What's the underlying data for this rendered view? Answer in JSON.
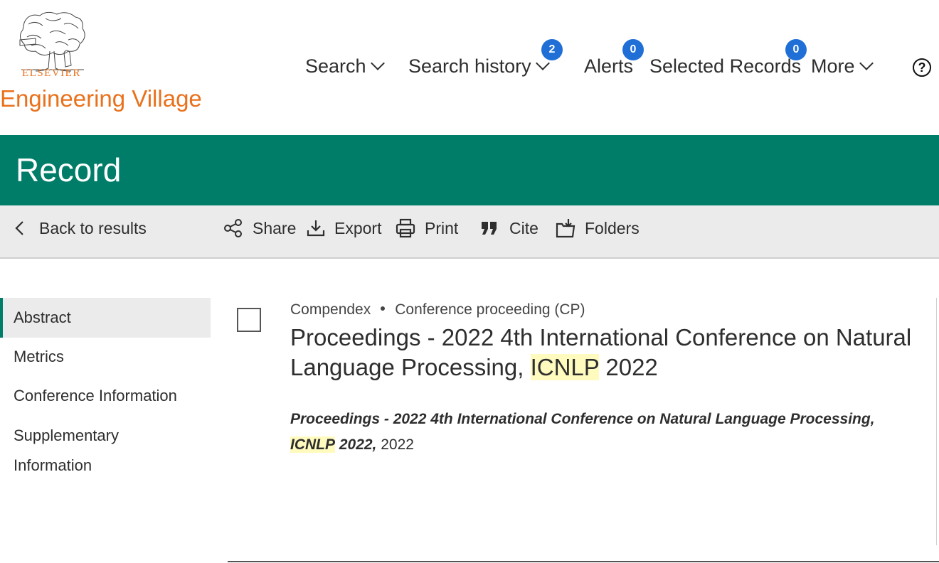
{
  "header": {
    "brand": "ELSEVIER",
    "product": "Engineering Village",
    "nav": {
      "search": "Search",
      "search_history": "Search history",
      "search_history_count": "2",
      "alerts": "Alerts",
      "alerts_count": "0",
      "selected_records": "Selected Records",
      "selected_records_count": "0",
      "more": "More",
      "help": "?"
    }
  },
  "page_title": "Record",
  "toolbar": {
    "back": "Back to results",
    "share": "Share",
    "export": "Export",
    "print": "Print",
    "cite": "Cite",
    "folders": "Folders"
  },
  "sidebar": {
    "items": [
      "Abstract",
      "Metrics",
      "Conference Information",
      "Supplementary",
      "Information"
    ]
  },
  "record": {
    "database": "Compendex",
    "doc_type": "Conference proceeding (CP)",
    "title_pre": "Proceedings - 2022 4th International Conference on Natural Language Processing,",
    "title_highlight": "ICNLP",
    "title_post": "2022",
    "source_pre": "Proceedings - 2022 4th International Conference on Natural Language Processing,",
    "source_highlight": "ICNLP",
    "source_post": "2022,",
    "year": "2022"
  },
  "colors": {
    "accent": "#007d69",
    "brand_orange": "#e9711c",
    "badge": "#1f6fd6",
    "highlight": "#fffbbf"
  }
}
